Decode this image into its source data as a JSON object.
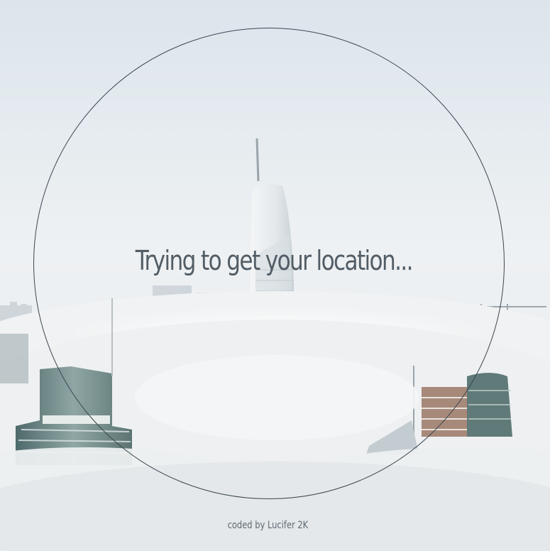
{
  "status": {
    "message": "Trying to get your location..."
  },
  "footer": {
    "credit": "coded by Lucifer 2K"
  },
  "colors": {
    "text": "#525d66",
    "circle_border": "#3b4650",
    "fog": "#eceff1"
  }
}
